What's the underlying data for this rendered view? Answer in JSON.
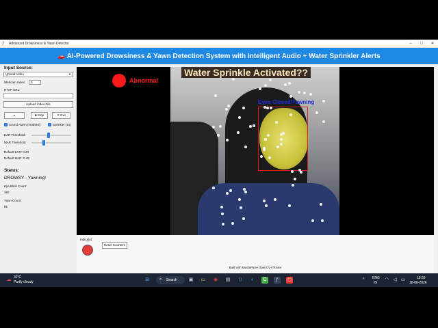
{
  "window": {
    "title": "Advanced Drowsiness & Yawn Detector",
    "icon": "feather-icon"
  },
  "header": {
    "icon": "car-icon",
    "title": "AI-Powered Drowsiness & Yawn Detection System with Intelligent Audio + Water Sprinkler Alerts"
  },
  "left_panel": {
    "input_source_title": "Input Source:",
    "source_selected": "Upload Video",
    "webcam_index_label": "Webcam Index:",
    "webcam_index_value": "0",
    "rtsp_label": "RTSP URL:",
    "rtsp_value": "",
    "upload_button": "Upload Video File",
    "start_button": "▸",
    "stop_button": "Stop",
    "exit_button": "Exit",
    "sound_alarm_label": "Sound Alarm (enabled)",
    "sprinkler_label": "Sprinkler (UI)",
    "ear_threshold_label": "EAR Threshold:",
    "ear_slider_fraction": 0.43,
    "mar_threshold_label": "MAR Threshold:",
    "mar_slider_fraction": 0.3,
    "default_ear": "Default EAR: 0.20",
    "default_mar": "Default MAR: 0.45",
    "status_title": "Status:",
    "status_value": "DROWSY - Yawning!",
    "eye_blink_label": "Eye Blink Count:",
    "eye_blink_value": "360",
    "yawn_count_label": "Yawn Count:",
    "yawn_count_value": "85"
  },
  "video_overlay": {
    "abnormal_label": "Abnormal",
    "sprinkle_banner": "Water Sprinkle Activated??",
    "detection_label": "Eyes Closed/Yawning"
  },
  "bottom": {
    "indicator_label": "Indicator",
    "indicator_color": "#e53935",
    "reset_button": "Reset Counters",
    "footer_text": "Built with MediaPipe+OpenCV+Tkinter"
  },
  "taskbar": {
    "weather_temp": "32°C",
    "weather_desc": "Partly cloudy",
    "search_label": "Search",
    "language": "ENG",
    "region": "IN",
    "time": "18:55",
    "date": "18-06-2026"
  }
}
